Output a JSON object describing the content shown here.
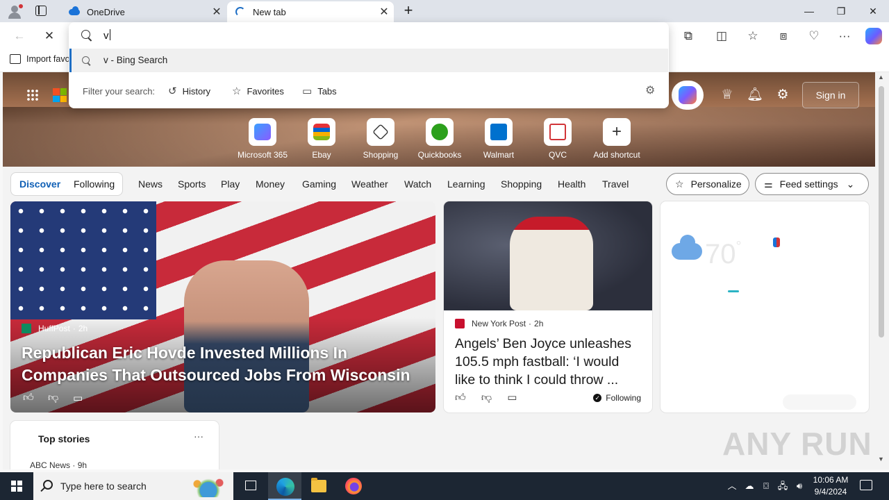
{
  "browser": {
    "tabs": [
      {
        "title": "OneDrive",
        "icon": "onedrive-cloud-icon"
      },
      {
        "title": "New tab",
        "icon": "loading-spinner-icon",
        "active": true
      }
    ],
    "favorites_bar": {
      "import_label": "Import favo"
    },
    "address_bar": {
      "value": "v",
      "suggestion": "v - Bing Search",
      "filter_label": "Filter your search:",
      "filters": [
        {
          "label": "History",
          "icon": "history-icon"
        },
        {
          "label": "Favorites",
          "icon": "star-icon"
        },
        {
          "label": "Tabs",
          "icon": "tabs-icon"
        }
      ]
    },
    "accent_color": "#1f6fc5"
  },
  "ntp": {
    "sign_in": "Sign in",
    "shortcuts": [
      {
        "label": "Microsoft 365",
        "color": "#6b5cff"
      },
      {
        "label": "Ebay",
        "color": "#e53238"
      },
      {
        "label": "Shopping",
        "color": "#333333"
      },
      {
        "label": "Quickbooks",
        "color": "#2ca01c"
      },
      {
        "label": "Walmart",
        "color": "#0071ce"
      },
      {
        "label": "QVC",
        "color": "#d13438"
      },
      {
        "label": "Add shortcut",
        "color": "#ffffff"
      }
    ],
    "feed_tabs": {
      "discover": "Discover",
      "following": "Following"
    },
    "categories": [
      "News",
      "Sports",
      "Play",
      "Money",
      "Gaming",
      "Weather",
      "Watch",
      "Learning",
      "Shopping",
      "Health",
      "Travel"
    ],
    "personalize": "Personalize",
    "feed_settings": "Feed settings",
    "main_card": {
      "source": "HuffPost",
      "age": "2h",
      "headline": "Republican Eric Hovde Invested Millions In Companies That Outsourced Jobs From Wisconsin"
    },
    "card_two": {
      "source": "New York Post",
      "age": "2h",
      "headline": "Angels’ Ben Joyce unleashes 105.5 mph fastball: ‘I would like to think I could throw ...",
      "following": "Following"
    },
    "weather": {
      "temp": "70",
      "unit": "°"
    },
    "top_stories": {
      "title": "Top stories",
      "more": "···",
      "source": "ABC News",
      "age": "9h"
    },
    "watermark": "ANY RUN"
  },
  "taskbar": {
    "search_placeholder": "Type here to search",
    "time": "10:06 AM",
    "date": "9/4/2024"
  }
}
